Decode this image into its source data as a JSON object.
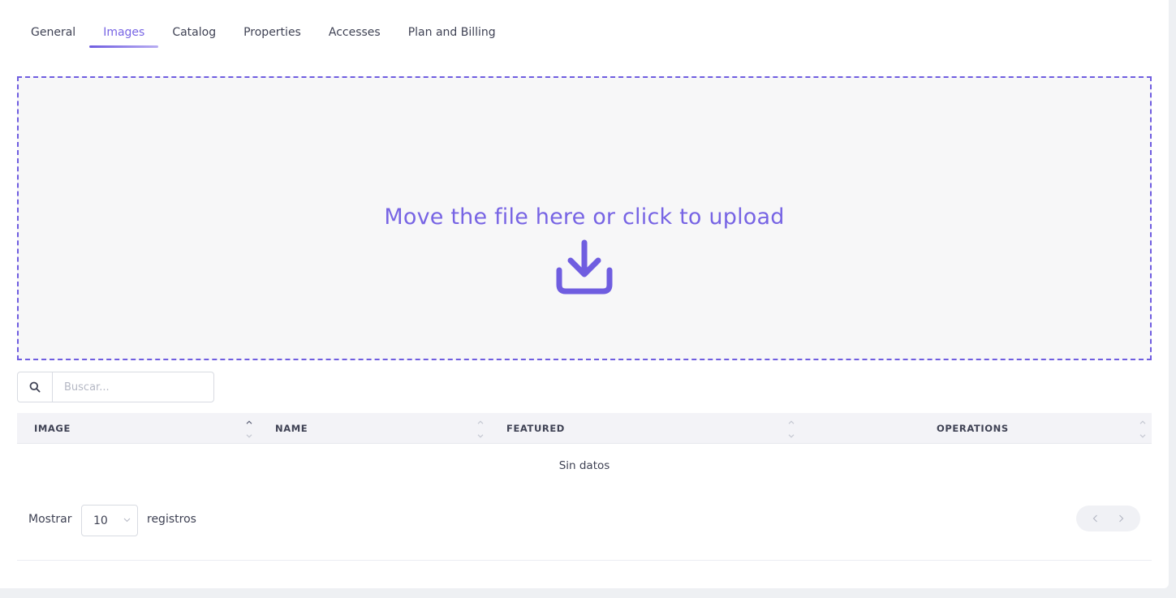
{
  "tabs": [
    {
      "label": "General",
      "active": false
    },
    {
      "label": "Images",
      "active": true
    },
    {
      "label": "Catalog",
      "active": false
    },
    {
      "label": "Properties",
      "active": false
    },
    {
      "label": "Accesses",
      "active": false
    },
    {
      "label": "Plan and Billing",
      "active": false
    }
  ],
  "dropzone": {
    "text": "Move the file here or click to upload",
    "icon": "download-icon",
    "color": "#6f5de0"
  },
  "search": {
    "icon": "search-icon",
    "placeholder": "Buscar..."
  },
  "table": {
    "columns": [
      "IMAGE",
      "NAME",
      "FEATURED",
      "OPERATIONS"
    ],
    "empty_text": "Sin datos"
  },
  "footer": {
    "show_label": "Mostrar",
    "page_size": "10",
    "records_label": "registros"
  },
  "pagination": {
    "prev_icon": "chevron-left-icon",
    "next_icon": "chevron-right-icon"
  }
}
